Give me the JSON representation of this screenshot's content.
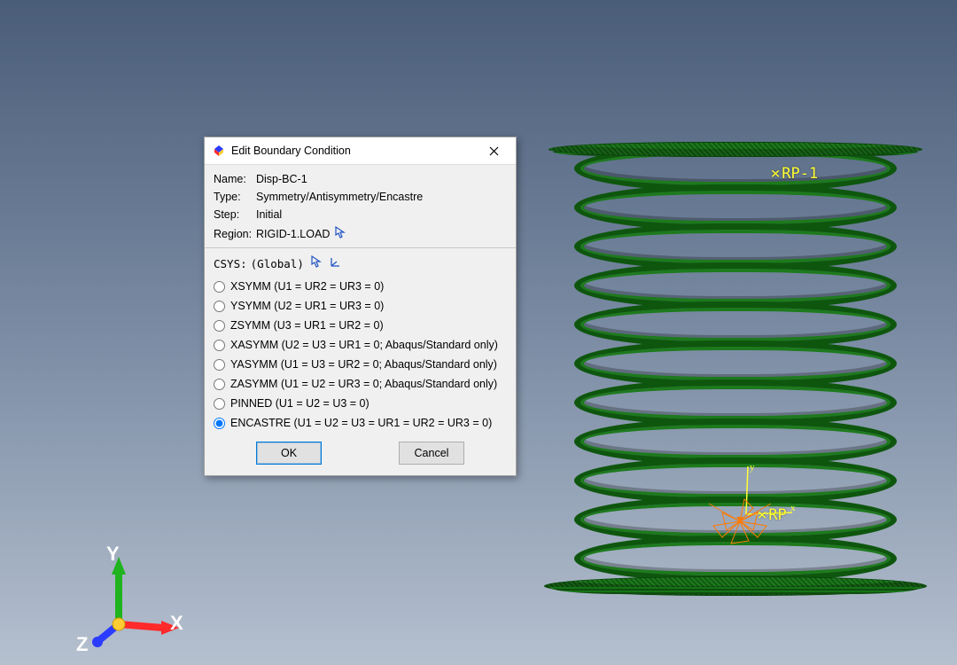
{
  "dialog": {
    "title": "Edit Boundary Condition",
    "fields": {
      "name_label": "Name:",
      "name_value": "Disp-BC-1",
      "type_label": "Type:",
      "type_value": "Symmetry/Antisymmetry/Encastre",
      "step_label": "Step:",
      "step_value": "Initial",
      "region_label": "Region:",
      "region_value": "RIGID-1.LOAD"
    },
    "csys_label": "CSYS:",
    "csys_value": "(Global)",
    "options": [
      "XSYMM (U1 = UR2 = UR3 = 0)",
      "YSYMM (U2 = UR1 = UR3 = 0)",
      "ZSYMM (U3 = UR1 = UR2 = 0)",
      "XASYMM (U2 = U3 = UR1 = 0; Abaqus/Standard only)",
      "YASYMM (U1 = U3 = UR2 = 0; Abaqus/Standard only)",
      "ZASYMM (U1 = U2 = UR3 = 0; Abaqus/Standard only)",
      "PINNED (U1 = U2 = U3 = 0)",
      "ENCASTRE (U1 = U2 = U3 = UR1 = UR2 = UR3 = 0)"
    ],
    "selected_index": 7,
    "ok_label": "OK",
    "cancel_label": "Cancel"
  },
  "viewport": {
    "ref_points": {
      "rp1": "RP-1",
      "rp2": "RP"
    },
    "local_axes": {
      "x": "x",
      "y": "y"
    },
    "global_axes": {
      "x": "X",
      "y": "Y",
      "z": "Z"
    }
  }
}
